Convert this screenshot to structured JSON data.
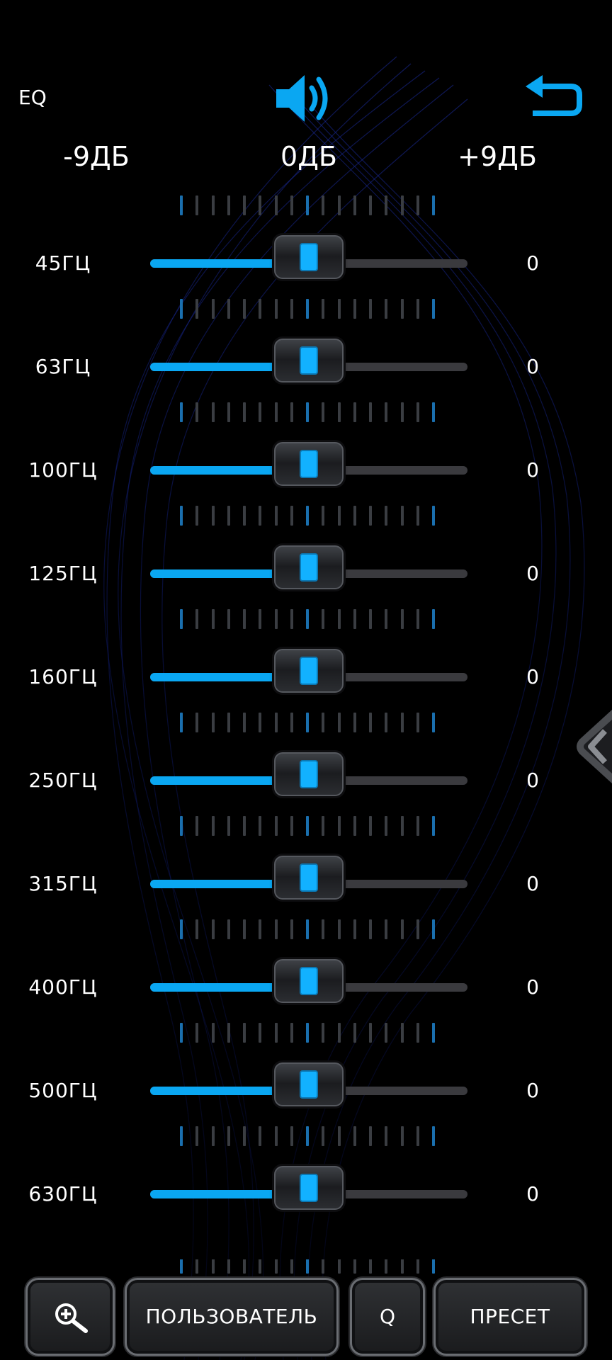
{
  "header": {
    "title": "EQ",
    "volume_icon": "speaker-volume-icon",
    "back_icon": "return-arrow-icon"
  },
  "scale": {
    "min_label": "-9ДБ",
    "mid_label": "0ДБ",
    "max_label": "+9ДБ",
    "min_db": -9,
    "max_db": 9
  },
  "bands": [
    {
      "label": "45ГЦ",
      "value": "0",
      "db": 0
    },
    {
      "label": "63ГЦ",
      "value": "0",
      "db": 0
    },
    {
      "label": "100ГЦ",
      "value": "0",
      "db": 0
    },
    {
      "label": "125ГЦ",
      "value": "0",
      "db": 0
    },
    {
      "label": "160ГЦ",
      "value": "0",
      "db": 0
    },
    {
      "label": "250ГЦ",
      "value": "0",
      "db": 0
    },
    {
      "label": "315ГЦ",
      "value": "0",
      "db": 0
    },
    {
      "label": "400ГЦ",
      "value": "0",
      "db": 0
    },
    {
      "label": "500ГЦ",
      "value": "0",
      "db": 0
    },
    {
      "label": "630ГЦ",
      "value": "0",
      "db": 0
    }
  ],
  "side_tab": {
    "icon": "chevron-left-icon"
  },
  "bottom_bar": {
    "zoom_icon": "zoom-in-icon",
    "user_label": "ПОЛЬЗОВАТЕЛЬ",
    "q_label": "Q",
    "preset_label": "ПРЕСЕТ"
  },
  "colors": {
    "accent": "#0aa7f2",
    "track": "#3a3a3e",
    "background": "#000000"
  }
}
